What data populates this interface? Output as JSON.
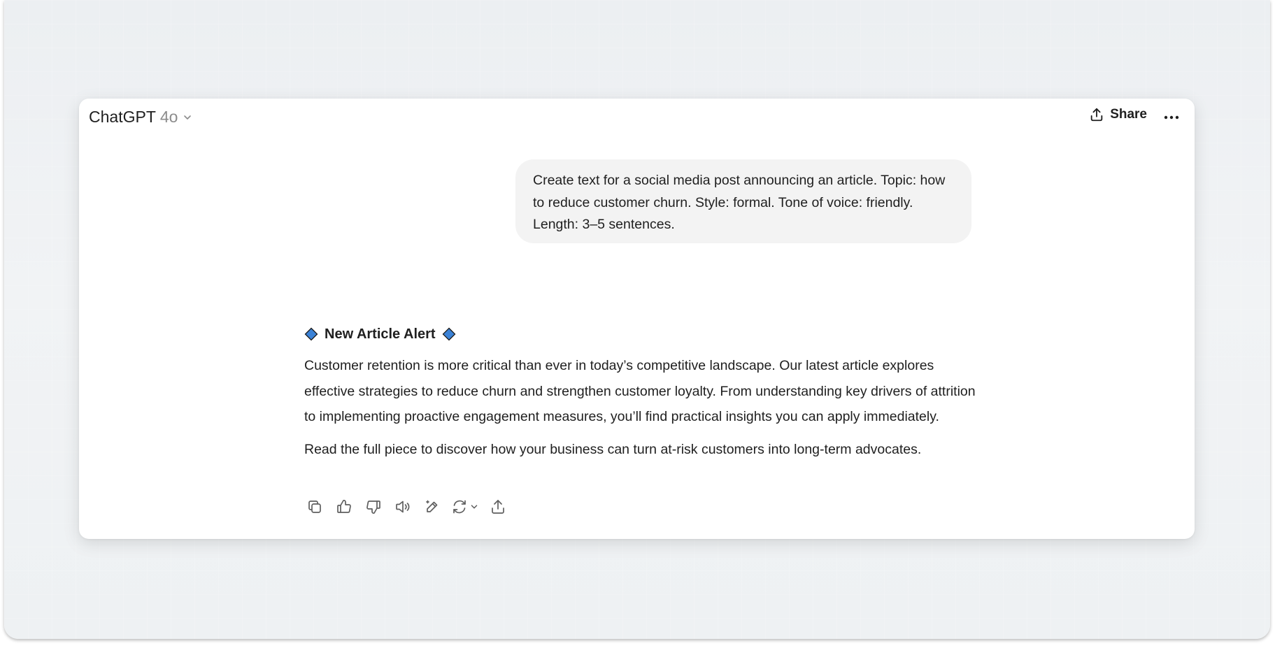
{
  "header": {
    "model_name": "ChatGPT",
    "model_version": "4o",
    "share_label": "Share"
  },
  "user_message": {
    "text": "Create text for a social media post announcing an article. Topic: how to reduce customer churn. Style: formal. Tone of voice: friendly. Length: 3–5 sentences."
  },
  "assistant_message": {
    "headline": "New Article Alert",
    "paragraph1": "Customer retention is more critical than ever in today’s competitive landscape. Our latest article explores effective strategies to reduce churn and strengthen customer loyalty. From understanding key drivers of attrition to implementing proactive engagement measures, you’ll find practical insights you can apply immediately.",
    "paragraph2": "Read the full piece to discover how your business can turn at-risk customers into long-term advocates."
  },
  "icons": {
    "headline_diamond": "blue-diamond-icon",
    "actions": [
      "copy-icon",
      "thumbs-up-icon",
      "thumbs-down-icon",
      "read-aloud-icon",
      "edit-icon",
      "regenerate-icon",
      "share-icon"
    ]
  },
  "colors": {
    "diamond_fill": "#3b82d6",
    "bubble_bg": "#f3f3f3",
    "text": "#1f1f1f"
  }
}
